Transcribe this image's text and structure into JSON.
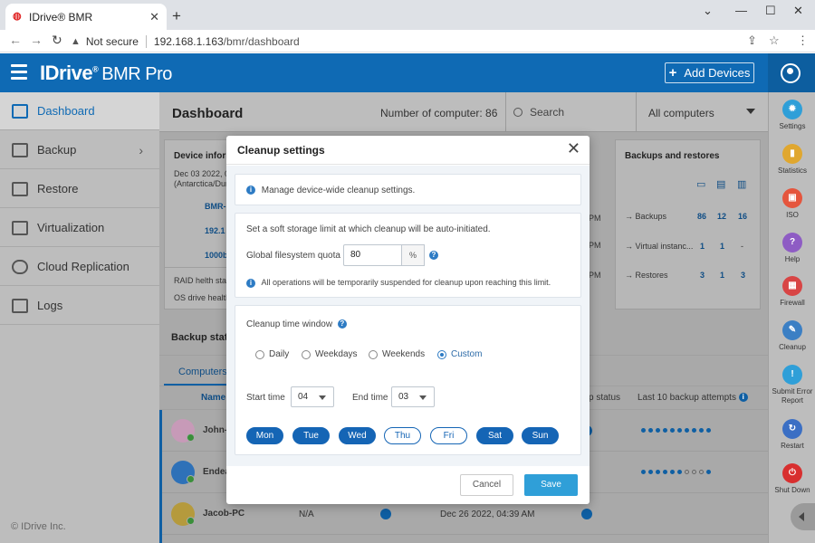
{
  "browser": {
    "tab_title": "IDrive® BMR",
    "tab_close": "✕",
    "new_tab": "+",
    "security": "Not secure",
    "url_host": "192.168.1.163",
    "url_path": "/bmr/dashboard"
  },
  "header": {
    "brand": "IDrive",
    "brand_reg": "®",
    "brand_sub": "BMR Pro",
    "add_devices_plus": "+",
    "add_devices": "Add Devices"
  },
  "sidebar": {
    "items": [
      {
        "label": "Dashboard",
        "active": true
      },
      {
        "label": "Backup",
        "chevron": "›"
      },
      {
        "label": "Restore"
      },
      {
        "label": "Virtualization"
      },
      {
        "label": "Cloud Replication"
      },
      {
        "label": "Logs"
      }
    ],
    "copyright": "© IDrive Inc."
  },
  "dashboard": {
    "title": "Dashboard",
    "num_computers_label": "Number of computer: 86",
    "search_placeholder": "Search",
    "filter": "All computers",
    "device_info": {
      "title": "Device inform",
      "date": "Dec 03 2022, 0:",
      "tz": "(Antarctica/Dur",
      "row1": "BMR-",
      "row2": "192.1",
      "row3": "1000b",
      "raid": "RAID helth stat",
      "osdrive": "OS drive health"
    },
    "mid_times": [
      "PM",
      "PM",
      "PM"
    ],
    "backups_restores": {
      "title": "Backups and restores",
      "rows": [
        {
          "label": "Backups",
          "v1": "86",
          "v2": "12",
          "v3": "16"
        },
        {
          "label": "Virtual instanc...",
          "v1": "1",
          "v2": "1",
          "v3": "-"
        },
        {
          "label": "Restores",
          "v1": "3",
          "v2": "1",
          "v3": "3"
        }
      ]
    },
    "backup_status_title": "Backup statu",
    "tab_computers": "Computers",
    "col_name": "Name",
    "col_backup_status": "p status",
    "col_last10": "Last 10 backup attempts",
    "rows": [
      {
        "name": "John-",
        "ip": "",
        "date": ""
      },
      {
        "name": "Endea",
        "ip": "",
        "date": ""
      },
      {
        "name": "Jacob-PC",
        "ip": "N/A",
        "date": "Dec 26 2022, 04:39 AM"
      }
    ]
  },
  "rail": {
    "items": [
      {
        "label": "Settings",
        "icon": "gear-icon",
        "color": "#2f9fd8"
      },
      {
        "label": "Statistics",
        "icon": "chart-icon",
        "color": "#e0a72f"
      },
      {
        "label": "ISO",
        "icon": "iso-icon",
        "color": "#e5553d"
      },
      {
        "label": "Help",
        "icon": "help-icon",
        "color": "#8e5cc4"
      },
      {
        "label": "Firewall",
        "icon": "firewall-icon",
        "color": "#d84545"
      },
      {
        "label": "Cleanup",
        "icon": "cleanup-icon",
        "color": "#3b7fc4"
      },
      {
        "label": "Submit Error Report",
        "icon": "error-report-icon",
        "color": "#2f9fd8"
      },
      {
        "label": "Restart",
        "icon": "restart-icon",
        "color": "#3b6fc4"
      },
      {
        "label": "Shut Down",
        "icon": "power-icon",
        "color": "#d82f2f"
      }
    ]
  },
  "modal": {
    "title": "Cleanup settings",
    "close": "✕",
    "info_text": "Manage device-wide cleanup settings.",
    "soft_limit_text": "Set a soft storage limit at which cleanup will be auto-initiated.",
    "quota_label": "Global filesystem quota",
    "quota_value": "80",
    "quota_unit": "%",
    "suspend_text": "All operations will be temporarily suspended for cleanup upon reaching this limit.",
    "window_label": "Cleanup time window",
    "options": [
      "Daily",
      "Weekdays",
      "Weekends",
      "Custom"
    ],
    "selected_option": "Custom",
    "start_label": "Start time",
    "start_value": "04",
    "end_label": "End time",
    "end_value": "03",
    "days": [
      {
        "label": "Mon",
        "on": true
      },
      {
        "label": "Tue",
        "on": true
      },
      {
        "label": "Wed",
        "on": true
      },
      {
        "label": "Thu",
        "on": false
      },
      {
        "label": "Fri",
        "on": false
      },
      {
        "label": "Sat",
        "on": true
      },
      {
        "label": "Sun",
        "on": true
      }
    ],
    "cancel": "Cancel",
    "save": "Save"
  },
  "colors": {
    "brand_blue": "#0f6ab4",
    "save_blue": "#2f9fd8",
    "day_blue": "#1565b5"
  }
}
